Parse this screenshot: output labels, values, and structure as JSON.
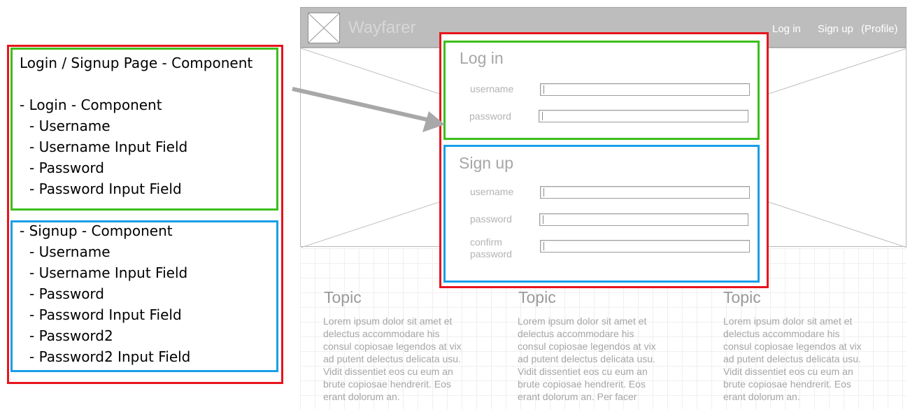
{
  "annotation": {
    "login_lines": [
      "Login / Signup Page - Component",
      "",
      "- Login - Component",
      "  - Username",
      "  - Username Input Field",
      "  - Password",
      "  - Password Input Field"
    ],
    "signup_lines": [
      "- Signup - Component",
      "  - Username",
      "  - Username Input Field",
      "  - Password",
      "  - Password Input Field",
      "  - Password2",
      "  - Password2 Input Field"
    ]
  },
  "wireframe": {
    "brand": "Wayfarer",
    "nav": [
      "Log in",
      "Sign up",
      "(Profile)"
    ],
    "login": {
      "title": "Log in",
      "username_label": "username",
      "password_label": "password"
    },
    "signup": {
      "title": "Sign up",
      "username_label": "username",
      "password_label": "password",
      "confirm_label_line1": "confirm",
      "confirm_label_line2": "password"
    },
    "topics": [
      {
        "title": "Topic",
        "body": [
          "Lorem ipsum dolor sit amet et",
          "delectus accommodare his",
          "consul copiosae legendos at vix",
          "ad putent delectus delicata usu.",
          "Vidit dissentiet eos cu eum an",
          "brute copiosae hendrerit. Eos",
          "erant dolorum an."
        ]
      },
      {
        "title": "Topic",
        "body": [
          "Lorem ipsum dolor sit amet et",
          "delectus accommodare his",
          "consul copiosae legendos at vix",
          "ad putent delectus delicata usu.",
          "Vidit dissentiet eos cu eum an",
          "brute copiosae hendrerit. Eos",
          "erant dolorum an. Per facer"
        ]
      },
      {
        "title": "Topic",
        "body": [
          "Lorem ipsum dolor sit amet et",
          "delectus accommodare his",
          "consul copiosae legendos at vix",
          "ad putent delectus delicata usu.",
          "Vidit dissentiet eos cu eum an",
          "brute copiosae hendrerit. Eos",
          "erant dolorum an."
        ]
      }
    ]
  },
  "colors": {
    "login_outline": "#3cbf1c",
    "signup_outline": "#1a9ee8",
    "page_outline": "#e8141c",
    "header_gray": "#bdbdbd",
    "arrow_gray": "#a8a8a8"
  },
  "icons": {
    "logo_placeholder": "image-placeholder-icon",
    "hero_placeholder": "image-placeholder-icon",
    "connector": "arrow-icon"
  }
}
